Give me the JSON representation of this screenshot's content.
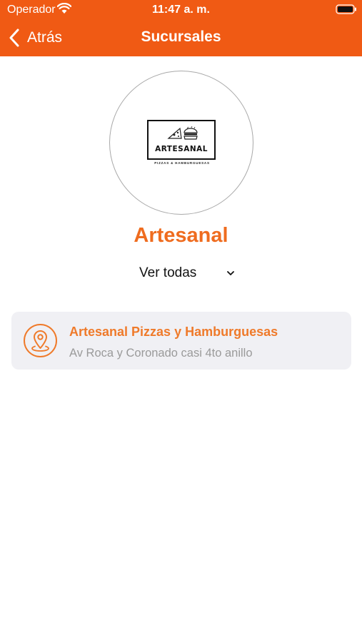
{
  "status_bar": {
    "carrier": "Operador",
    "time": "11:47 a. m.",
    "wifi_icon": "wifi-icon",
    "battery_icon": "battery-icon"
  },
  "nav": {
    "back_label": "Atrás",
    "title": "Sucursales",
    "back_icon": "chevron-left-icon"
  },
  "brand": {
    "logo_text": "ARTESANAL",
    "logo_subtext": "PIZZAS & HAMBURGUESAS",
    "name": "Artesanal"
  },
  "filter": {
    "label": "Ver todas",
    "icon": "chevron-down-icon"
  },
  "branches": [
    {
      "name": "Artesanal Pizzas y Hamburguesas",
      "address": "Av Roca y Coronado casi 4to anillo",
      "icon": "location-pin-icon"
    }
  ],
  "colors": {
    "primary": "#f05a14",
    "accent_text": "#ef6c1f",
    "card_background": "#f0f0f4",
    "secondary_text": "#9a9a9a"
  }
}
